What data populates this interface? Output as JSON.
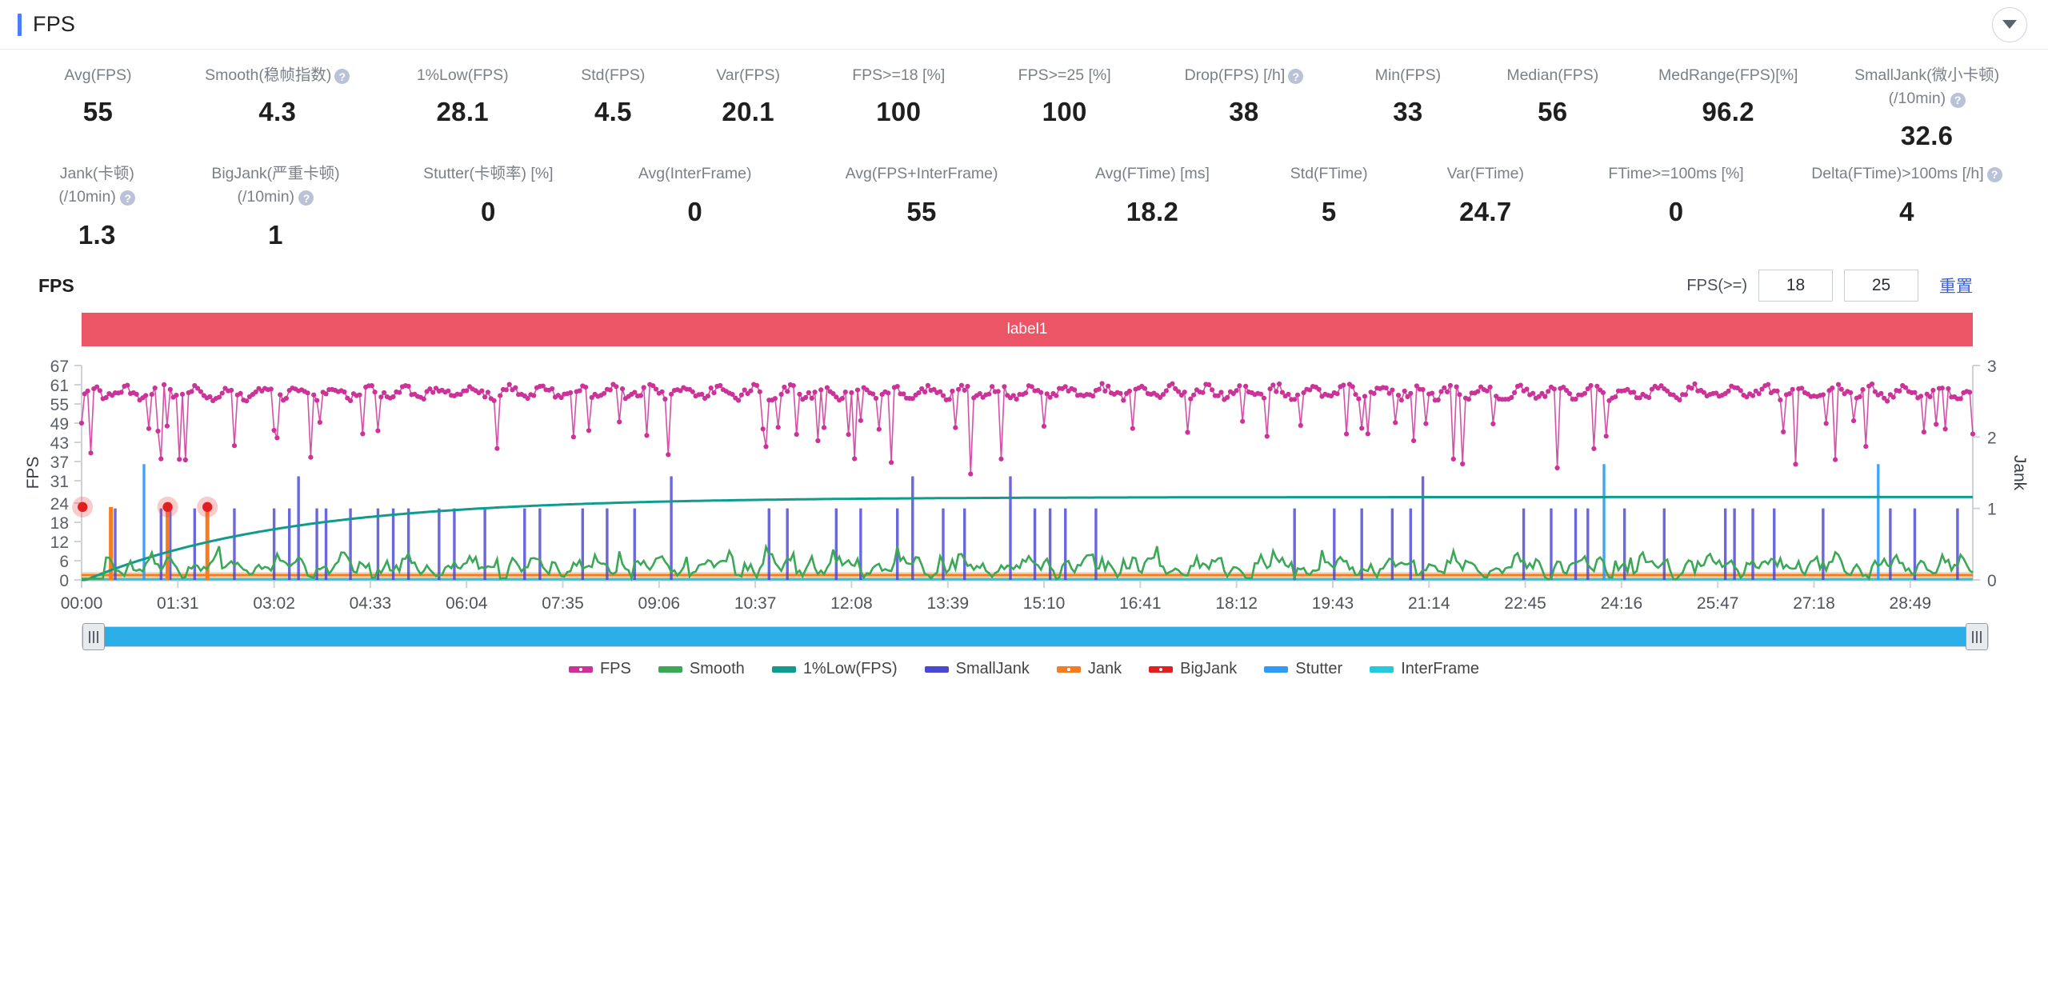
{
  "header": {
    "title": "FPS",
    "collapse_icon": "chevron-down-icon"
  },
  "metrics_row1": [
    {
      "label": "Avg(FPS)",
      "value": "55",
      "help": false
    },
    {
      "label": "Smooth(稳帧指数)",
      "value": "4.3",
      "help": true
    },
    {
      "label": "1%Low(FPS)",
      "value": "28.1",
      "help": false
    },
    {
      "label": "Std(FPS)",
      "value": "4.5",
      "help": false
    },
    {
      "label": "Var(FPS)",
      "value": "20.1",
      "help": false
    },
    {
      "label": "FPS>=18 [%]",
      "value": "100",
      "help": false
    },
    {
      "label": "FPS>=25 [%]",
      "value": "100",
      "help": false
    },
    {
      "label": "Drop(FPS) [/h]",
      "value": "38",
      "help": true
    },
    {
      "label": "Min(FPS)",
      "value": "33",
      "help": false
    },
    {
      "label": "Median(FPS)",
      "value": "56",
      "help": false
    },
    {
      "label": "MedRange(FPS)[%]",
      "value": "96.2",
      "help": false
    },
    {
      "label": "SmallJank(微小卡顿)",
      "label2": "(/10min)",
      "value": "32.6",
      "help": true
    }
  ],
  "metrics_row2": [
    {
      "label": "Jank(卡顿)",
      "label2": "(/10min)",
      "value": "1.3",
      "help": true
    },
    {
      "label": "BigJank(严重卡顿)",
      "label2": "(/10min)",
      "value": "1",
      "help": true
    },
    {
      "label": "Stutter(卡顿率) [%]",
      "value": "0",
      "help": false
    },
    {
      "label": "Avg(InterFrame)",
      "value": "0",
      "help": false
    },
    {
      "label": "Avg(FPS+InterFrame)",
      "value": "55",
      "help": false
    },
    {
      "label": "Avg(FTime) [ms]",
      "value": "18.2",
      "help": false
    },
    {
      "label": "Std(FTime)",
      "value": "5",
      "help": false
    },
    {
      "label": "Var(FTime)",
      "value": "24.7",
      "help": false
    },
    {
      "label": "FTime>=100ms [%]",
      "value": "0",
      "help": false
    },
    {
      "label": "Delta(FTime)>100ms [/h]",
      "value": "4",
      "help": true
    }
  ],
  "chart_section": {
    "title": "FPS",
    "fps_threshold_label": "FPS(>=)",
    "threshold_low": "18",
    "threshold_high": "25",
    "reset_label": "重置",
    "band_label": "label1",
    "band_color": "#ec5565"
  },
  "chart_data": {
    "type": "line",
    "title": "FPS",
    "xlabel": "",
    "ylabel": "FPS",
    "y2label": "Jank",
    "ylim": [
      0,
      67
    ],
    "y2lim": [
      0,
      3
    ],
    "yticks": [
      0,
      6,
      12,
      18,
      24,
      31,
      37,
      43,
      49,
      55,
      61,
      67
    ],
    "y2ticks": [
      0,
      1,
      2,
      3
    ],
    "xticks": [
      "00:00",
      "01:31",
      "03:02",
      "04:33",
      "06:04",
      "07:35",
      "09:06",
      "10:37",
      "12:08",
      "13:39",
      "15:10",
      "16:41",
      "18:12",
      "19:43",
      "21:14",
      "22:45",
      "24:16",
      "25:47",
      "27:18",
      "28:49"
    ],
    "grid": false,
    "legend_position": "bottom",
    "series": [
      {
        "name": "FPS",
        "color": "#cc3399",
        "type": "line-markers",
        "axis": "left",
        "mean": 58,
        "min": 33,
        "max": 61
      },
      {
        "name": "Smooth",
        "color": "#3aa856",
        "type": "line",
        "axis": "left",
        "mean": 4.3,
        "min": 0,
        "max": 9
      },
      {
        "name": "1%Low(FPS)",
        "color": "#0f9b8e",
        "type": "line",
        "axis": "left",
        "mean": 22,
        "min": 0,
        "max": 26
      },
      {
        "name": "SmallJank",
        "color": "#4a47d5",
        "type": "impulse",
        "axis": "right",
        "count": 98,
        "peak": 1
      },
      {
        "name": "Jank",
        "color": "#f57c20",
        "type": "impulse",
        "axis": "right",
        "count": 4,
        "peak": 1
      },
      {
        "name": "BigJank",
        "color": "#e02020",
        "type": "scatter",
        "axis": "right",
        "count": 4,
        "peak": 1
      },
      {
        "name": "Stutter",
        "color": "#2f9bf5",
        "type": "impulse",
        "axis": "right",
        "count": 3,
        "peak": 1
      },
      {
        "name": "InterFrame",
        "color": "#25c9dd",
        "type": "line",
        "axis": "right",
        "mean": 0,
        "max": 0
      }
    ]
  },
  "legend": [
    {
      "label": "FPS",
      "color": "#cc3399",
      "marker": "dotted"
    },
    {
      "label": "Smooth",
      "color": "#3aa856",
      "marker": "bar"
    },
    {
      "label": "1%Low(FPS)",
      "color": "#0f9b8e",
      "marker": "bar"
    },
    {
      "label": "SmallJank",
      "color": "#4a47d5",
      "marker": "bar"
    },
    {
      "label": "Jank",
      "color": "#f57c20",
      "marker": "dotted"
    },
    {
      "label": "BigJank",
      "color": "#e02020",
      "marker": "dotted"
    },
    {
      "label": "Stutter",
      "color": "#2f9bf5",
      "marker": "bar"
    },
    {
      "label": "InterFrame",
      "color": "#25c9dd",
      "marker": "bar"
    }
  ],
  "slider": {
    "left_handle": "slider-handle-left",
    "right_handle": "slider-handle-right"
  }
}
